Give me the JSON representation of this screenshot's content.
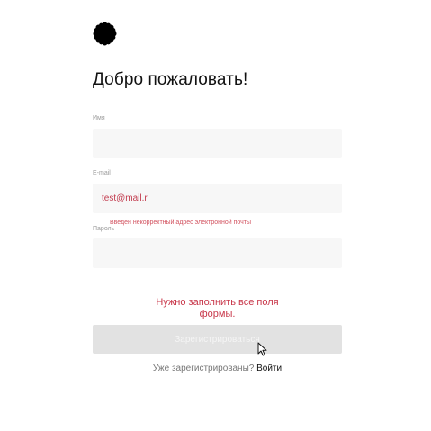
{
  "page": {
    "title": "Добро пожаловать!"
  },
  "form": {
    "name_label": "Имя",
    "name_value": "",
    "email_label": "E-mail",
    "email_value": "test@mail.r",
    "email_error": "Введен некорректный адрес электронной почты",
    "password_label": "Пароль",
    "password_value": "",
    "form_error_line1": "Нужно заполнить все поля",
    "form_error_line2": "формы.",
    "submit_label": "Зарегистрироваться"
  },
  "footer": {
    "already_registered": "Уже зарегистрированы?",
    "signin_link": "Войти"
  },
  "icons": {
    "logo": "scalloped-circle-logo-icon",
    "cursor": "mouse-pointer-icon"
  },
  "colors": {
    "error": "#c8374a",
    "input_bg": "#f7f7f7",
    "button_disabled": "#e2e2e2"
  }
}
